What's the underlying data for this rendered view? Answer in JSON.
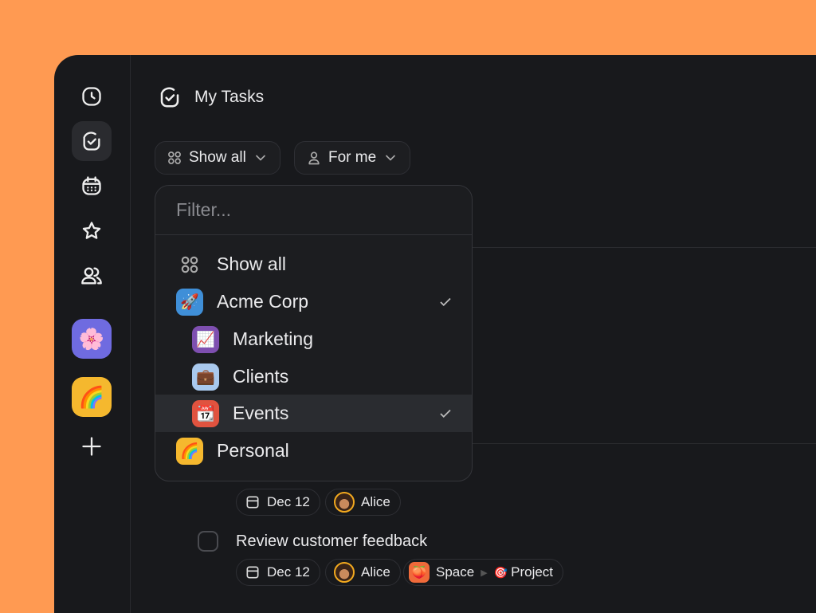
{
  "sidebar": {
    "items": [
      {
        "icon": "clock-icon"
      },
      {
        "icon": "check-circle-icon",
        "active": true
      },
      {
        "icon": "calendar-icon"
      },
      {
        "icon": "star-icon"
      },
      {
        "icon": "users-icon"
      }
    ],
    "spaces": [
      {
        "emoji": "🌸",
        "color": "#6F6BE0"
      },
      {
        "emoji": "🌈",
        "color": "#F5B82E"
      }
    ],
    "add_icon": "plus-icon"
  },
  "header": {
    "title": "My Tasks"
  },
  "filters": {
    "scope": "Show all",
    "assignee": "For me"
  },
  "dropdown": {
    "placeholder": "Filter...",
    "items": [
      {
        "label": "Show all",
        "icon": "grid-icon",
        "checked": false
      },
      {
        "label": "Acme Corp",
        "emoji": "🚀",
        "color": "#3F8FD8",
        "checked": true
      },
      {
        "label": "Marketing",
        "emoji": "📈",
        "color": "#7E4FB0",
        "checked": false,
        "indent": true
      },
      {
        "label": "Clients",
        "emoji": "💼",
        "color": "#A9C9EE",
        "checked": false,
        "indent": true
      },
      {
        "label": "Events",
        "emoji": "📆",
        "color": "#E0533F",
        "checked": true,
        "indent": true,
        "highlighted": true
      },
      {
        "label": "Personal",
        "emoji": "🌈",
        "color": "#F5B82E",
        "checked": false
      }
    ]
  },
  "tasks": [
    {
      "date": "Dec 12",
      "assignee": "Alice"
    },
    {
      "title": "Review customer feedback",
      "date": "Dec 12",
      "assignee": "Alice",
      "space": "Space",
      "space_emoji": "🍑",
      "project": "Project",
      "project_emoji": "🎯"
    }
  ]
}
